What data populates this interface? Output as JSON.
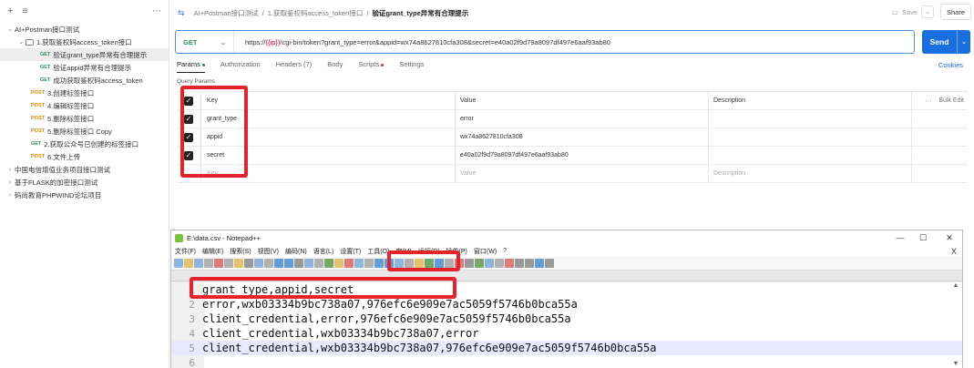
{
  "sidebar": {
    "add_icon": "+",
    "menu_icon": "≡",
    "more_icon": "⋯",
    "items": [
      {
        "label": "AI+Postman接口测试",
        "level": 0,
        "chevron": "⌄",
        "method": ""
      },
      {
        "label": "1.获取鉴权码access_token接口",
        "level": 1,
        "chevron": "⌄",
        "method": "",
        "folder": true
      },
      {
        "label": "验证grant_type异常有合理提示",
        "level": 2,
        "chevron": "",
        "method": "GET",
        "selected": true
      },
      {
        "label": "验证appid异常有合理提示",
        "level": 2,
        "chevron": "",
        "method": "GET"
      },
      {
        "label": "成功获取鉴权码access_token",
        "level": 2,
        "chevron": "",
        "method": "GET"
      },
      {
        "label": "3.创建标签接口",
        "level": 1,
        "chevron": "",
        "method": "POST"
      },
      {
        "label": "4.编辑标签接口",
        "level": 1,
        "chevron": "",
        "method": "POST"
      },
      {
        "label": "5.删除标签接口",
        "level": 1,
        "chevron": "",
        "method": "POST"
      },
      {
        "label": "5.删除标签接口 Copy",
        "level": 1,
        "chevron": "",
        "method": "POST"
      },
      {
        "label": "2.获取公众号已创建的标签接口",
        "level": 1,
        "chevron": "",
        "method": "GET"
      },
      {
        "label": "6.文件上传",
        "level": 1,
        "chevron": "",
        "method": "POST"
      },
      {
        "label": "中国电信增值业务项目接口测试",
        "level": 0,
        "chevron": "›",
        "method": ""
      },
      {
        "label": "基于FLASK的加密接口测试",
        "level": 0,
        "chevron": "›",
        "method": ""
      },
      {
        "label": "码尚教育PHPWIND论坛项目",
        "level": 0,
        "chevron": "›",
        "method": ""
      }
    ]
  },
  "breadcrumb": {
    "icon": "⇆",
    "parts": [
      "AI+Postman接口测试",
      "1.获取鉴权码access_token接口"
    ],
    "separator": "/",
    "current": "验证grant_type异常有合理提示"
  },
  "toolbar": {
    "save_label": "Save",
    "share_label": "Share",
    "save_icon": "▭",
    "dropdown_icon": "⌄"
  },
  "request": {
    "method": "GET",
    "method_chevron": "⌄",
    "url_prefix": "https://",
    "url_var": "{{ip}}",
    "url_rest": "/cgi-bin/token?grant_type=error&appid=wx74a8627810cfa308&secret=e40a02f9d79a8097df497e6aaf93ab80",
    "send_label": "Send",
    "send_chevron": "⌄"
  },
  "tabs": [
    {
      "label": "Params",
      "dot": "#2e8b57",
      "active": true
    },
    {
      "label": "Authorization"
    },
    {
      "label": "Headers (7)"
    },
    {
      "label": "Body"
    },
    {
      "label": "Scripts",
      "dot": "#e8222a"
    },
    {
      "label": "Settings"
    }
  ],
  "cookies_label": "Cookies",
  "query_params_label": "Query Params",
  "params_table": {
    "headers": {
      "key": "Key",
      "value": "Value",
      "description": "Description",
      "bulk_edit": "Bulk Edit",
      "more_icon": "⋯"
    },
    "rows": [
      {
        "checked": true,
        "key": "grant_type",
        "value": "error",
        "description": ""
      },
      {
        "checked": true,
        "key": "appid",
        "value": "wx74a8627810cfa308",
        "description": ""
      },
      {
        "checked": true,
        "key": "secret",
        "value": "e40a02f9d79a8097df497e6aaf93ab80",
        "description": ""
      }
    ],
    "placeholder": {
      "key": "Key",
      "value": "Value",
      "description": "Description"
    }
  },
  "notepad": {
    "title": "E:\\data.csv - Notepad++",
    "controls": {
      "minimize": "—",
      "maximize": "☐",
      "close": "✕"
    },
    "menu_close": "X",
    "menu": [
      "文件(F)",
      "编辑(E)",
      "搜索(S)",
      "视图(V)",
      "编码(N)",
      "语言(L)",
      "设置(T)",
      "工具(O)",
      "宏(M)",
      "运行(R)",
      "插件(P)",
      "窗口(W)",
      "?"
    ],
    "lines": [
      {
        "num": "1",
        "text": "grant_type,appid,secret"
      },
      {
        "num": "2",
        "text": "error,wxb03334b9bc738a07,976efc6e909e7ac5059f5746b0bca55a"
      },
      {
        "num": "3",
        "text": "client_credential,error,976efc6e909e7ac5059f5746b0bca55a"
      },
      {
        "num": "4",
        "text": "client_credential,wxb03334b9bc738a07,error"
      },
      {
        "num": "5",
        "text": "client_credential,wxb03334b9bc738a07,976efc6e909e7ac5059f5746b0bca55a"
      },
      {
        "num": "6",
        "text": ""
      }
    ],
    "scroll_up": "▲",
    "scroll_down": "▼"
  },
  "colors": {
    "accent": "#1a6fe0",
    "highlight": "#e8222a",
    "get": "#2e8b57",
    "post": "#d08a00"
  }
}
